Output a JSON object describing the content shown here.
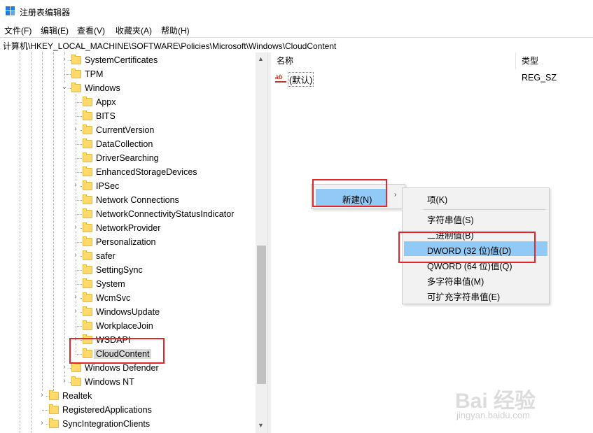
{
  "window": {
    "title": "注册表编辑器"
  },
  "menu": [
    "文件(F)",
    "编辑(E)",
    "查看(V)",
    "收藏夹(A)",
    "帮助(H)"
  ],
  "address": "计算机\\HKEY_LOCAL_MACHINE\\SOFTWARE\\Policies\\Microsoft\\Windows\\CloudContent",
  "tree": [
    {
      "label": "SystemCertificates",
      "level": 2,
      "expander": "collapsed"
    },
    {
      "label": "TPM",
      "level": 2,
      "expander": "none"
    },
    {
      "label": "Windows",
      "level": 2,
      "expander": "expanded"
    },
    {
      "label": "Appx",
      "level": 3,
      "expander": "none"
    },
    {
      "label": "BITS",
      "level": 3,
      "expander": "none"
    },
    {
      "label": "CurrentVersion",
      "level": 3,
      "expander": "collapsed"
    },
    {
      "label": "DataCollection",
      "level": 3,
      "expander": "none"
    },
    {
      "label": "DriverSearching",
      "level": 3,
      "expander": "none"
    },
    {
      "label": "EnhancedStorageDevices",
      "level": 3,
      "expander": "none"
    },
    {
      "label": "IPSec",
      "level": 3,
      "expander": "collapsed"
    },
    {
      "label": "Network Connections",
      "level": 3,
      "expander": "none"
    },
    {
      "label": "NetworkConnectivityStatusIndicator",
      "level": 3,
      "expander": "none"
    },
    {
      "label": "NetworkProvider",
      "level": 3,
      "expander": "collapsed"
    },
    {
      "label": "Personalization",
      "level": 3,
      "expander": "none"
    },
    {
      "label": "safer",
      "level": 3,
      "expander": "collapsed"
    },
    {
      "label": "SettingSync",
      "level": 3,
      "expander": "none"
    },
    {
      "label": "System",
      "level": 3,
      "expander": "none"
    },
    {
      "label": "WcmSvc",
      "level": 3,
      "expander": "collapsed"
    },
    {
      "label": "WindowsUpdate",
      "level": 3,
      "expander": "collapsed"
    },
    {
      "label": "WorkplaceJoin",
      "level": 3,
      "expander": "none"
    },
    {
      "label": "WSDAPI",
      "level": 3,
      "expander": "collapsed"
    },
    {
      "label": "CloudContent",
      "level": 3,
      "expander": "none",
      "selected": true
    },
    {
      "label": "Windows Defender",
      "level": 2,
      "expander": "collapsed"
    },
    {
      "label": "Windows NT",
      "level": 2,
      "expander": "collapsed"
    },
    {
      "label": "Realtek",
      "level": 1,
      "expander": "collapsed"
    },
    {
      "label": "RegisteredApplications",
      "level": 1,
      "expander": "none"
    },
    {
      "label": "SyncIntegrationClients",
      "level": 1,
      "expander": "collapsed"
    }
  ],
  "list": {
    "columns": {
      "name": "名称",
      "type": "类型"
    },
    "rows": [
      {
        "icon": "ab",
        "name": "(默认)",
        "type": "REG_SZ"
      }
    ]
  },
  "context_menu": {
    "new_label": "新建(N)",
    "submenu": [
      "项(K)",
      "字符串值(S)",
      "二进制值(B)",
      "DWORD (32 位)值(D)",
      "QWORD (64 位)值(Q)",
      "多字符串值(M)",
      "可扩充字符串值(E)"
    ]
  },
  "watermark": {
    "brand": "Bai 经验",
    "url": "jingyan.baidu.com"
  },
  "colors": {
    "highlight": "#91c9f7",
    "annotation": "#e3262b",
    "folder": "#ffd969",
    "app_icon": "#1a7fd8"
  }
}
